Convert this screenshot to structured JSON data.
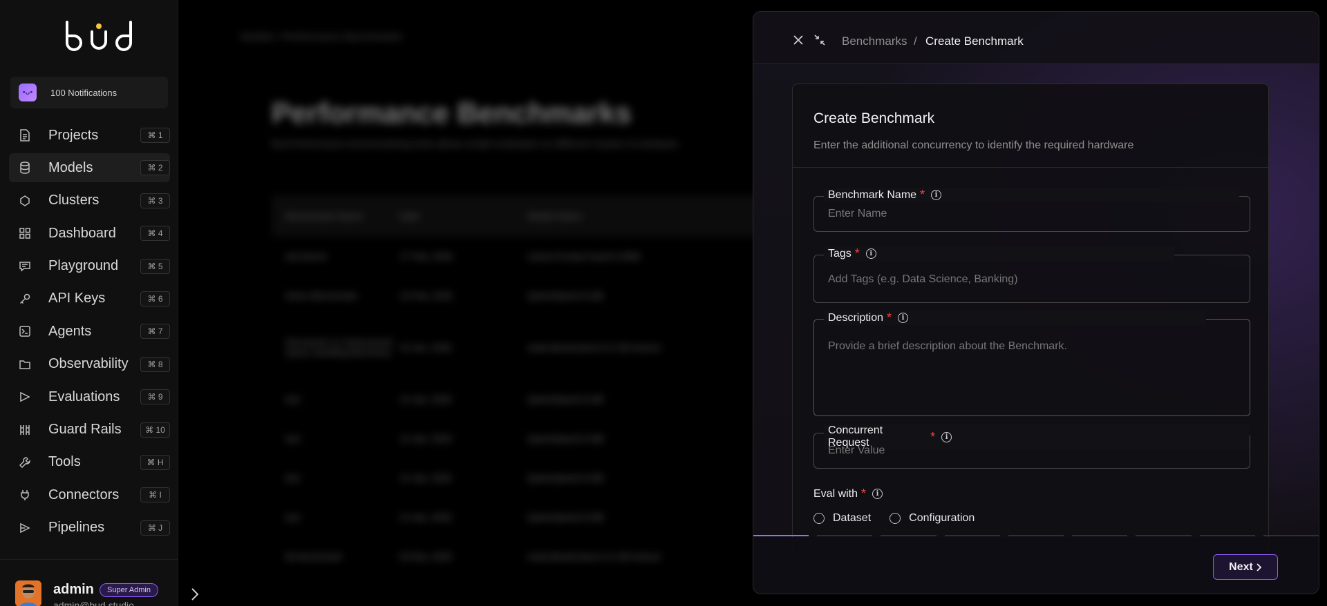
{
  "sidebar": {
    "logo": "bud",
    "notifications": "100 Notifications",
    "items": [
      {
        "label": "Projects",
        "icon": "document-icon",
        "shortcut": "⌘ 1"
      },
      {
        "label": "Models",
        "icon": "database-icon",
        "shortcut": "⌘ 2"
      },
      {
        "label": "Clusters",
        "icon": "cluster-icon",
        "shortcut": "⌘ 3"
      },
      {
        "label": "Dashboard",
        "icon": "grid-icon",
        "shortcut": "⌘ 4"
      },
      {
        "label": "Playground",
        "icon": "chat-icon",
        "shortcut": "⌘ 5"
      },
      {
        "label": "API Keys",
        "icon": "key-icon",
        "shortcut": "⌘ 6"
      },
      {
        "label": "Agents",
        "icon": "terminal-icon",
        "shortcut": "⌘ 7"
      },
      {
        "label": "Observability",
        "icon": "folder-icon",
        "shortcut": "⌘ 8"
      },
      {
        "label": "Evaluations",
        "icon": "flow-icon",
        "shortcut": "⌘ 9"
      },
      {
        "label": "Guard Rails",
        "icon": "rails-icon",
        "shortcut": "⌘ 10"
      },
      {
        "label": "Tools",
        "icon": "wrench-icon",
        "shortcut": "⌘ H"
      },
      {
        "label": "Connectors",
        "icon": "plug-icon",
        "shortcut": "⌘ I"
      },
      {
        "label": "Pipelines",
        "icon": "pipeline-icon",
        "shortcut": "⌘ J"
      }
    ],
    "active_index": 1,
    "user": {
      "name": "admin",
      "role": "Super Admin",
      "email": "admin@bud.studio"
    }
  },
  "background": {
    "breadcrumb": "Models   /   Performance Benchmarks",
    "title": "Performance Benchmarks",
    "subtitle": "Bud Performance benchmarking tools allows model evaluation on different clusters & hardware",
    "columns": [
      "Benchmark Name",
      "Date",
      "Model Name"
    ],
    "rows": [
      [
        "test bench",
        "17 Feb, 2026",
        "Llama-Prompt-Guard-2-86M"
      ],
      [
        "Demo Benchmark",
        "13 Feb, 2026",
        "Qwen/Qwen3-0.6B"
      ],
      [
        "Structured vs Unstructured Query Handling Benchmar",
        "15 Jan, 2026",
        "meta-llama/Llama-3.2-1B-Instruct"
      ],
      [
        "test",
        "14 Jan, 2026",
        "Qwen/Qwen3-0.6B"
      ],
      [
        "test",
        "14 Jan, 2026",
        "Qwen/Qwen3-0.6B"
      ],
      [
        "test",
        "14 Jan, 2026",
        "Qwen/Qwen3-0.6B"
      ],
      [
        "test",
        "14 Jan, 2026",
        "Qwen/Qwen3-0.6B"
      ],
      [
        "bk benchmark",
        "04 Nov, 2025",
        "meta-llama/Llama-3.2-1B-Instruct"
      ]
    ]
  },
  "drawer": {
    "breadcrumb_parent": "Benchmarks",
    "breadcrumb_sep": "/",
    "breadcrumb_current": "Create Benchmark",
    "card_title": "Create Benchmark",
    "card_desc": "Enter the additional concurrency to identify the required hardware",
    "fields": {
      "name": {
        "label": "Benchmark Name",
        "placeholder": "Enter Name"
      },
      "tags": {
        "label": "Tags",
        "placeholder": "Add Tags (e.g. Data Science, Banking)"
      },
      "description": {
        "label": "Description",
        "placeholder": "Provide a brief description about the Benchmark."
      },
      "concurrent": {
        "label": "Concurrent Request",
        "placeholder": "Enter Value"
      }
    },
    "eval_with": {
      "label": "Eval with",
      "options": [
        "Dataset",
        "Configuration"
      ]
    },
    "progress": {
      "total_steps": 9,
      "current_step": 1
    },
    "next_label": "Next"
  },
  "colors": {
    "accent": "#8b5cf6",
    "required": "#ef4444",
    "background": "#000000"
  }
}
